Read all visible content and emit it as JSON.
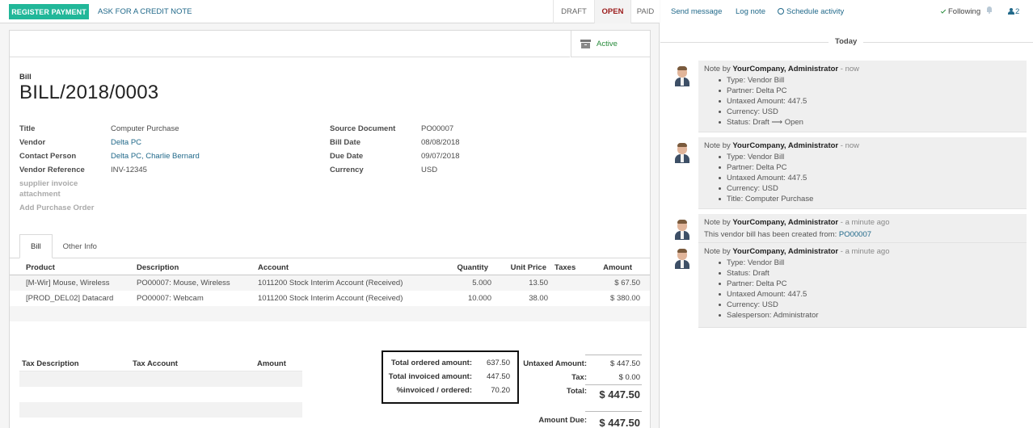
{
  "statusbar": {
    "register_payment": "REGISTER PAYMENT",
    "credit_note": "ASK FOR A CREDIT NOTE",
    "stages": [
      "DRAFT",
      "OPEN",
      "PAID"
    ],
    "active_stage": "OPEN"
  },
  "button_box": {
    "active_label": "Active"
  },
  "document": {
    "type": "Bill",
    "name": "BILL/2018/0003"
  },
  "fields_left": [
    {
      "label": "Title",
      "value": "Computer Purchase",
      "link": false
    },
    {
      "label": "Vendor",
      "value": "Delta PC",
      "link": true
    },
    {
      "label": "Contact Person",
      "value": "Delta PC, Charlie Bernard",
      "link": true
    },
    {
      "label": "Vendor Reference",
      "value": "INV-12345",
      "link": false
    }
  ],
  "muted_fields": {
    "attachment_line1": "supplier invoice",
    "attachment_line2": "attachment",
    "add_purchase_order": "Add Purchase Order"
  },
  "fields_right": [
    {
      "label": "Source Document",
      "value": "PO00007"
    },
    {
      "label": "Bill Date",
      "value": "08/08/2018"
    },
    {
      "label": "Due Date",
      "value": "09/07/2018"
    },
    {
      "label": "Currency",
      "value": "USD"
    }
  ],
  "tabs": [
    "Bill",
    "Other Info"
  ],
  "lines": {
    "headers": [
      "Product",
      "Description",
      "Account",
      "Quantity",
      "Unit Price",
      "Taxes",
      "Amount"
    ],
    "rows": [
      [
        "[M-Wir] Mouse, Wireless",
        "PO00007: Mouse, Wireless",
        "1011200 Stock Interim Account (Received)",
        "5.000",
        "13.50",
        "",
        "$ 67.50"
      ],
      [
        "[PROD_DEL02] Datacard",
        "PO00007: Webcam",
        "1011200 Stock Interim Account (Received)",
        "10.000",
        "38.00",
        "",
        "$ 380.00"
      ]
    ]
  },
  "taxes": {
    "headers": [
      "Tax Description",
      "Tax Account",
      "Amount"
    ]
  },
  "highlight": {
    "rows": [
      {
        "label": "Total ordered amount:",
        "value": "637.50"
      },
      {
        "label": "Total invoiced amount:",
        "value": "447.50"
      },
      {
        "label": "%invoiced / ordered:",
        "value": "70.20"
      }
    ]
  },
  "totals": {
    "untaxed_label": "Untaxed Amount:",
    "untaxed_value": "$ 447.50",
    "tax_label": "Tax:",
    "tax_value": "$ 0.00",
    "total_label": "Total:",
    "total_value": "$ 447.50",
    "due_label": "Amount Due:",
    "due_value": "$ 447.50"
  },
  "chatter": {
    "send_message": "Send message",
    "log_note": "Log note",
    "schedule_activity": "Schedule activity",
    "following": "Following",
    "followers_count": "2",
    "day_label": "Today",
    "messages": [
      {
        "prefix": "Note by",
        "author": "YourCompany, Administrator",
        "time": "- now",
        "items": [
          "Type: Vendor Bill",
          "Partner: Delta PC",
          "Untaxed Amount: 447.5",
          "Currency: USD",
          "Status: Draft ⟶ Open"
        ]
      },
      {
        "prefix": "Note by",
        "author": "YourCompany, Administrator",
        "time": "- now",
        "items": [
          "Type: Vendor Bill",
          "Partner: Delta PC",
          "Untaxed Amount: 447.5",
          "Currency: USD",
          "Title: Computer Purchase"
        ]
      },
      {
        "prefix": "Note by",
        "author": "YourCompany, Administrator",
        "time": "- a minute ago",
        "text": "This vendor bill has been created from:",
        "link": "PO00007"
      },
      {
        "prefix": "Note by",
        "author": "YourCompany, Administrator",
        "time": "- a minute ago",
        "items": [
          "Type: Vendor Bill",
          "Status: Draft",
          "Partner: Delta PC",
          "Untaxed Amount: 447.5",
          "Currency: USD",
          "Salesperson: Administrator"
        ]
      }
    ]
  }
}
